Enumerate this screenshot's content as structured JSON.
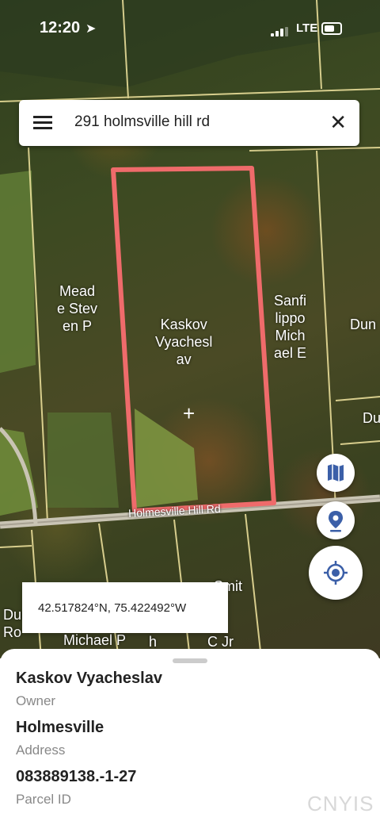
{
  "status_bar": {
    "time": "12:20",
    "network": "LTE"
  },
  "search": {
    "value": "291 holmsville hill rd"
  },
  "map": {
    "parcel_labels": [
      {
        "key": "meade",
        "text": "Mead\ne Stev\nen P"
      },
      {
        "key": "kaskov",
        "text": "Kaskov\nVyachesl\nav"
      },
      {
        "key": "sanfilippo",
        "text": "Sanfi\nlippo\nMich\nael E"
      },
      {
        "key": "dun-right",
        "text": "Dun"
      },
      {
        "key": "du-right",
        "text": "Du"
      },
      {
        "key": "smit",
        "text": "Smit"
      },
      {
        "key": "le-cjr",
        "text": "le\nC Jr"
      },
      {
        "key": "h",
        "text": "h"
      },
      {
        "key": "dun-left",
        "text": "Dun\nRo"
      },
      {
        "key": "michael-p",
        "text": "Michael P"
      }
    ],
    "road_label": "Holmesville Hill Rd",
    "highlight_color": "#ef6b6b"
  },
  "coordinates": "42.517824°N, 75.422492°W",
  "buttons": {
    "map_layers_icon": "map-icon",
    "location_pin_icon": "location-pin-icon",
    "my_location_icon": "gps-crosshair-icon"
  },
  "details": {
    "owner_value": "Kaskov Vyacheslav",
    "owner_label": "Owner",
    "address_value": "Holmesville",
    "address_label": "Address",
    "parcel_value": "083889138.-1-27",
    "parcel_label": "Parcel ID"
  },
  "watermark": "CNYIS",
  "colors": {
    "accent": "#3b5fa8",
    "parcel_outline": "#ef6b6b",
    "boundary": "#f3e6a0"
  }
}
